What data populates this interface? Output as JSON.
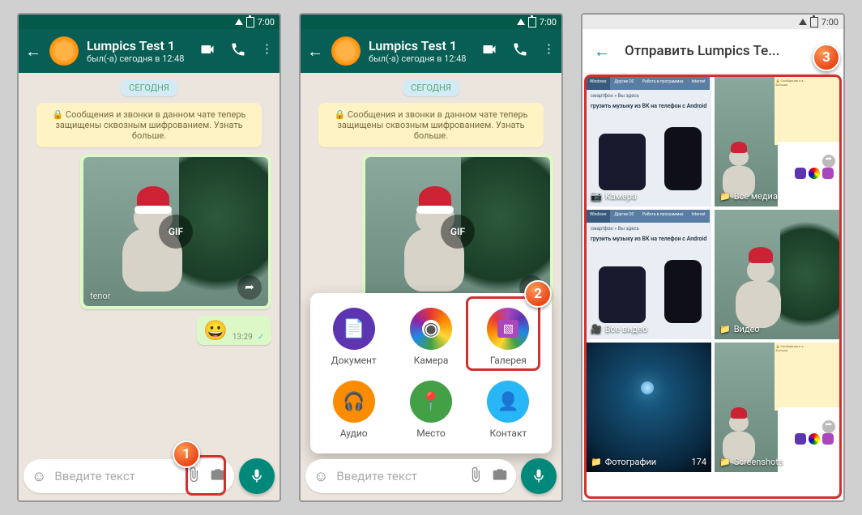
{
  "status_time": "7:00",
  "contact": {
    "name": "Lumpics Test 1",
    "status": "был(-а) сегодня в 12:48"
  },
  "date_badge": "СЕГОДНЯ",
  "encryption_notice": "🔒 Сообщения и звонки в данном чате теперь защищены сквозным шифрованием. Узнать больше.",
  "gif_label": "GIF",
  "tenor_label": "tenor",
  "emoji_msg": {
    "emoji": "😀",
    "time": "13:29"
  },
  "input_placeholder": "Введите текст",
  "attach_items": [
    {
      "label": "Документ",
      "color": "#5e35b1",
      "icon": "📄"
    },
    {
      "label": "Камера",
      "color_grad": true,
      "icon": "◉"
    },
    {
      "label": "Галерея",
      "color": "#ab47bc",
      "icon": "🖼"
    },
    {
      "label": "Аудио",
      "color": "#fb8c00",
      "icon": "🎧"
    },
    {
      "label": "Место",
      "color": "#43a047",
      "icon": "📍"
    },
    {
      "label": "Контакт",
      "color": "#29b6f6",
      "icon": "👤"
    }
  ],
  "gallery": {
    "title": "Отправить Lumpics Te...",
    "folders": [
      {
        "label": "Камера",
        "icon": "📷",
        "count": ""
      },
      {
        "label": "Все медиа",
        "icon": "📁",
        "count": ""
      },
      {
        "label": "Все видео",
        "icon": "🎥",
        "count": ""
      },
      {
        "label": "Видео",
        "icon": "📁",
        "count": ""
      },
      {
        "label": "Фотографии",
        "icon": "📁",
        "count": "174"
      },
      {
        "label": "Screenshots",
        "icon": "📁",
        "count": ""
      }
    ]
  },
  "steps": {
    "s1": "1",
    "s2": "2",
    "s3": "3"
  }
}
